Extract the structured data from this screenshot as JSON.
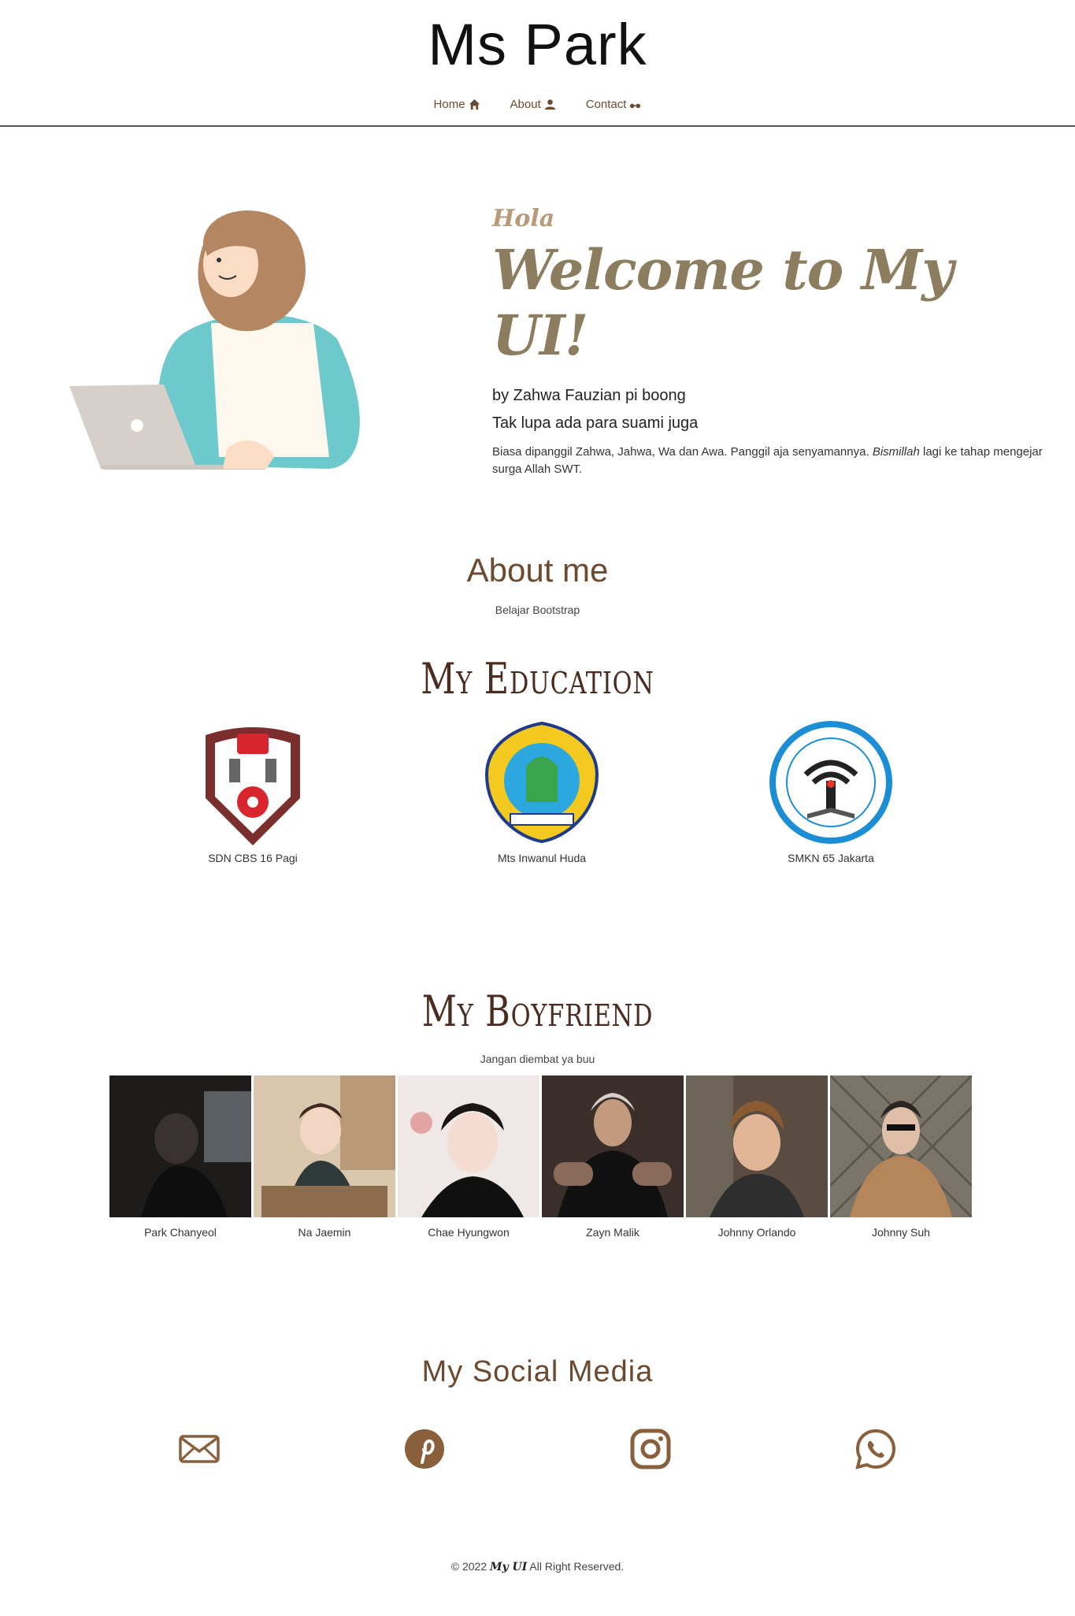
{
  "header": {
    "brand": "Ms Park",
    "nav": [
      {
        "label": "Home",
        "icon": "home-icon"
      },
      {
        "label": "About",
        "icon": "user-icon"
      },
      {
        "label": "Contact",
        "icon": "glasses-icon"
      }
    ]
  },
  "hero": {
    "greeting": "Hola",
    "title": "Welcome to My UI!",
    "byline": "by Zahwa Fauzian pi boong",
    "line2": "Tak lupa ada para suami juga",
    "desc_before": "Biasa dipanggil Zahwa, Jahwa, Wa dan Awa. Panggil aja senyamannya. ",
    "desc_em": "Bismillah",
    "desc_after": " lagi ke tahap mengejar surga Allah SWT."
  },
  "about": {
    "title": "About me",
    "subtitle": "Belajar Bootstrap"
  },
  "education": {
    "title": "My Education",
    "items": [
      {
        "name": "SDN CBS 16 Pagi",
        "logo": "sd-logo"
      },
      {
        "name": "Mts Inwanul Huda",
        "logo": "mts-logo"
      },
      {
        "name": "SMKN 65 Jakarta",
        "logo": "smk-logo"
      }
    ]
  },
  "boyfriend": {
    "title": "My Boyfriend",
    "subtitle": "Jangan diembat ya buu",
    "items": [
      {
        "name": "Park Chanyeol"
      },
      {
        "name": "Na Jaemin"
      },
      {
        "name": "Chae Hyungwon"
      },
      {
        "name": "Zayn Malik"
      },
      {
        "name": "Johnny Orlando"
      },
      {
        "name": "Johnny Suh"
      }
    ]
  },
  "social": {
    "title": "My Social Media",
    "icons": [
      "mail-icon",
      "pinterest-icon",
      "instagram-icon",
      "whatsapp-icon"
    ],
    "color": "#8a5f3c"
  },
  "footer": {
    "prefix": "© 2022",
    "brand": "My UI",
    "suffix": "All Right Reserved."
  }
}
